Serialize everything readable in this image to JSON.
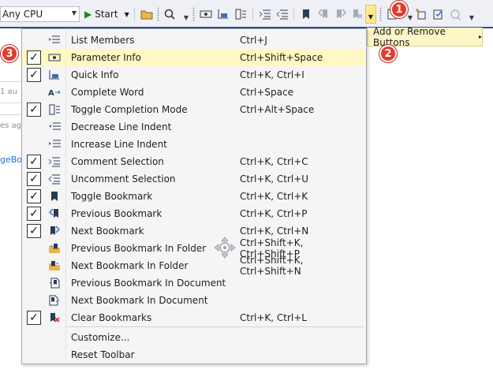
{
  "toolbar": {
    "platform": "Any CPU",
    "start_label": "Start"
  },
  "background": {
    "fragment_1": "1 au",
    "fragment_2": "es ago",
    "fragment_3": "geBo"
  },
  "add_remove_label": "Add or Remove Buttons",
  "menu": {
    "items": [
      {
        "label": "List Members",
        "shortcut": "Ctrl+J",
        "checked": false,
        "icon": "list-members-icon"
      },
      {
        "label": "Parameter Info",
        "shortcut": "Ctrl+Shift+Space",
        "checked": true,
        "icon": "parameter-info-icon"
      },
      {
        "label": "Quick Info",
        "shortcut": "Ctrl+K, Ctrl+I",
        "checked": true,
        "icon": "quick-info-icon"
      },
      {
        "label": "Complete Word",
        "shortcut": "Ctrl+Space",
        "checked": false,
        "icon": "complete-word-icon"
      },
      {
        "label": "Toggle Completion Mode",
        "shortcut": "Ctrl+Alt+Space",
        "checked": true,
        "icon": "completion-mode-icon"
      },
      {
        "label": "Decrease Line Indent",
        "shortcut": "",
        "checked": false,
        "icon": "decrease-indent-icon"
      },
      {
        "label": "Increase Line Indent",
        "shortcut": "",
        "checked": false,
        "icon": "increase-indent-icon"
      },
      {
        "label": "Comment Selection",
        "shortcut": "Ctrl+K, Ctrl+C",
        "checked": true,
        "icon": "comment-icon"
      },
      {
        "label": "Uncomment Selection",
        "shortcut": "Ctrl+K, Ctrl+U",
        "checked": true,
        "icon": "uncomment-icon"
      },
      {
        "label": "Toggle Bookmark",
        "shortcut": "Ctrl+K, Ctrl+K",
        "checked": true,
        "icon": "bookmark-icon"
      },
      {
        "label": "Previous Bookmark",
        "shortcut": "Ctrl+K, Ctrl+P",
        "checked": true,
        "icon": "previous-bookmark-icon"
      },
      {
        "label": "Next Bookmark",
        "shortcut": "Ctrl+K, Ctrl+N",
        "checked": true,
        "icon": "next-bookmark-icon"
      },
      {
        "label": "Previous Bookmark In Folder",
        "shortcut": "Ctrl+Shift+K, Ctrl+Shift+P",
        "checked": false,
        "icon": "previous-bookmark-folder-icon"
      },
      {
        "label": "Next Bookmark In Folder",
        "shortcut": "Ctrl+Shift+K, Ctrl+Shift+N",
        "checked": false,
        "icon": "next-bookmark-folder-icon"
      },
      {
        "label": "Previous Bookmark In Document",
        "shortcut": "",
        "checked": false,
        "icon": "previous-bookmark-document-icon"
      },
      {
        "label": "Next Bookmark In Document",
        "shortcut": "",
        "checked": false,
        "icon": "next-bookmark-document-icon"
      },
      {
        "label": "Clear Bookmarks",
        "shortcut": "Ctrl+K, Ctrl+L",
        "checked": true,
        "icon": "clear-bookmarks-icon"
      }
    ],
    "customize_label": "Customize...",
    "reset_label": "Reset Toolbar"
  },
  "callouts": {
    "one": "1",
    "two": "2",
    "three": "3"
  },
  "colors": {
    "highlight": "#fff8c3",
    "badge": "#e23b2c",
    "accent_line": "#2f4f8f",
    "overflow_button": "#ffe98a"
  }
}
